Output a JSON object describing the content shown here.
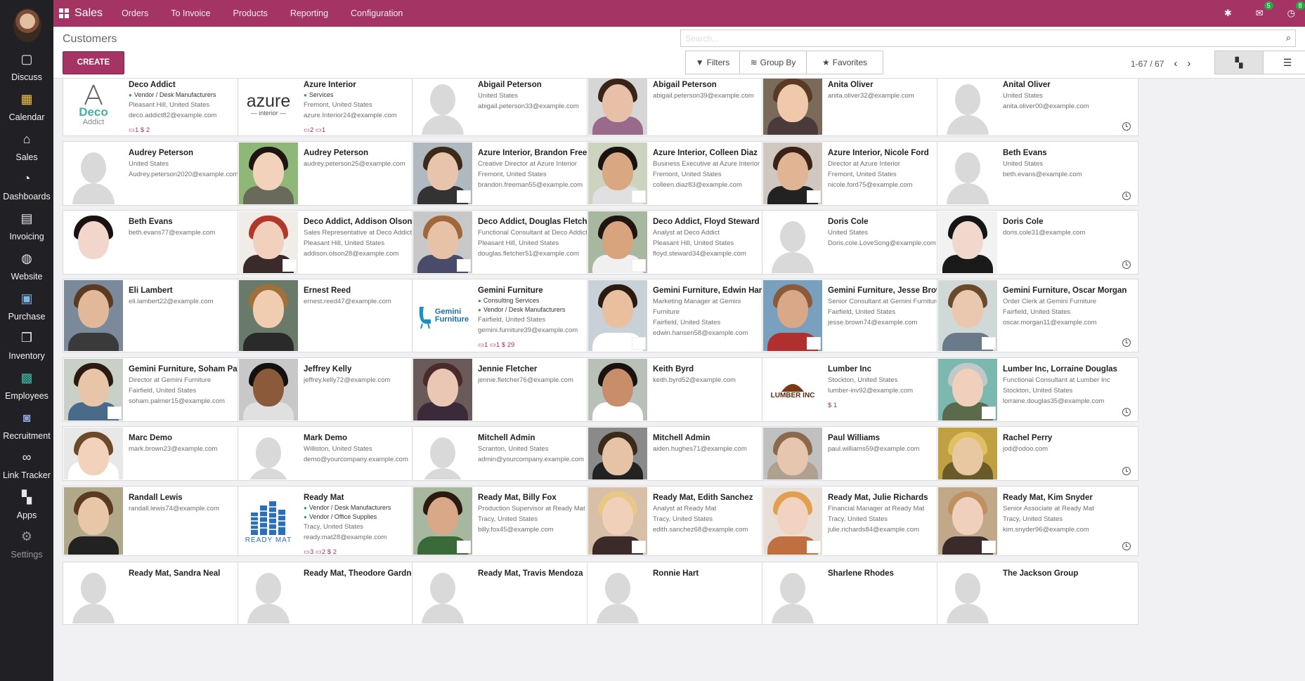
{
  "app": {
    "name": "Sales"
  },
  "topbar": {
    "menu": [
      "Orders",
      "To Invoice",
      "Products",
      "Reporting",
      "Configuration"
    ],
    "messages_count": "5",
    "activities_count": "8"
  },
  "rail": [
    "Discuss",
    "Calendar",
    "Sales",
    "Dashboards",
    "Invoicing",
    "Website",
    "Purchase",
    "Inventory",
    "Employees",
    "Recruitment",
    "Link Tracker",
    "Apps",
    "Settings"
  ],
  "control_panel": {
    "title": "Customers",
    "create_label": "CREATE",
    "search_placeholder": "Search...",
    "filters_label": "Filters",
    "groupby_label": "Group By",
    "favorites_label": "Favorites",
    "pager": "1-67 / 67"
  },
  "cards": [
    {
      "name": "Deco Addict",
      "tags": [
        "Vendor / Desk Manufacturers"
      ],
      "lines": [
        "Pleasant Hill, United States",
        "deco.addict82@example.com"
      ],
      "stats": "▭1   $ 2"
    },
    {
      "name": "Azure Interior",
      "tags": [
        "Services"
      ],
      "lines": [
        "Fremont, United States",
        "azure.Interior24@example.com"
      ],
      "stats": "▭2   ▭1"
    },
    {
      "name": "Abigail Peterson",
      "tags": [],
      "lines": [
        "United States",
        "abigail.peterson33@example.com"
      ],
      "stats": ""
    },
    {
      "name": "Abigail Peterson",
      "tags": [],
      "lines": [
        "abigail.peterson39@example.com"
      ],
      "stats": ""
    },
    {
      "name": "Anita Oliver",
      "tags": [],
      "lines": [
        "anita.oliver32@example.com"
      ],
      "stats": ""
    },
    {
      "name": "Anital Oliver",
      "tags": [],
      "lines": [
        "United States",
        "anita.oliver00@example.com"
      ],
      "stats": ""
    },
    {
      "name": "Audrey Peterson",
      "tags": [],
      "lines": [
        "United States",
        "Audrey.peterson2020@example.com"
      ],
      "stats": ""
    },
    {
      "name": "Audrey Peterson",
      "tags": [],
      "lines": [
        "audrey.peterson25@example.com"
      ],
      "stats": ""
    },
    {
      "name": "Azure Interior, Brandon Freeman",
      "tags": [],
      "lines": [
        "Creative Director at Azure Interior",
        "Fremont, United States",
        "brandon.freeman55@example.com"
      ],
      "stats": ""
    },
    {
      "name": "Azure Interior, Colleen Diaz",
      "tags": [],
      "lines": [
        "Business Executive at Azure Interior",
        "Fremont, United States",
        "colleen.diaz83@example.com"
      ],
      "stats": ""
    },
    {
      "name": "Azure Interior, Nicole Ford",
      "tags": [],
      "lines": [
        "Director at Azure Interior",
        "Fremont, United States",
        "nicole.ford75@example.com"
      ],
      "stats": ""
    },
    {
      "name": "Beth Evans",
      "tags": [],
      "lines": [
        "United States",
        "beth.evans@example.com"
      ],
      "stats": ""
    },
    {
      "name": "Beth Evans",
      "tags": [],
      "lines": [
        "beth.evans77@example.com"
      ],
      "stats": ""
    },
    {
      "name": "Deco Addict, Addison Olson",
      "tags": [],
      "lines": [
        "Sales Representative at Deco Addict",
        "Pleasant Hill, United States",
        "addison.olson28@example.com"
      ],
      "stats": ""
    },
    {
      "name": "Deco Addict, Douglas Fletcher",
      "tags": [],
      "lines": [
        "Functional Consultant at Deco Addict",
        "Pleasant Hill, United States",
        "douglas.fletcher51@example.com"
      ],
      "stats": ""
    },
    {
      "name": "Deco Addict, Floyd Steward",
      "tags": [],
      "lines": [
        "Analyst at Deco Addict",
        "Pleasant Hill, United States",
        "floyd.steward34@example.com"
      ],
      "stats": ""
    },
    {
      "name": "Doris Cole",
      "tags": [],
      "lines": [
        "United States",
        "Doris.cole.LoveSong@example.com"
      ],
      "stats": ""
    },
    {
      "name": "Doris Cole",
      "tags": [],
      "lines": [
        "doris.cole31@example.com"
      ],
      "stats": ""
    },
    {
      "name": "Eli Lambert",
      "tags": [],
      "lines": [
        "eli.lambert22@example.com"
      ],
      "stats": ""
    },
    {
      "name": "Ernest Reed",
      "tags": [],
      "lines": [
        "ernest.reed47@example.com"
      ],
      "stats": ""
    },
    {
      "name": "Gemini Furniture",
      "tags": [
        "Consulting Services",
        "Vendor / Desk Manufacturers"
      ],
      "lines": [
        "Fairfield, United States",
        "gemini.furniture39@example.com"
      ],
      "stats": "▭1   ▭1   $ 29"
    },
    {
      "name": "Gemini Furniture, Edwin Hansen",
      "tags": [],
      "lines": [
        "Marketing Manager at Gemini",
        "Furniture",
        "Fairfield, United States",
        "edwin.hansen58@example.com"
      ],
      "stats": ""
    },
    {
      "name": "Gemini Furniture, Jesse Brown",
      "tags": [],
      "lines": [
        "Senior Consultant at Gemini Furniture",
        "Fairfield, United States",
        "jesse.brown74@example.com"
      ],
      "stats": ""
    },
    {
      "name": "Gemini Furniture, Oscar Morgan",
      "tags": [],
      "lines": [
        "Order Clerk at Gemini Furniture",
        "Fairfield, United States",
        "oscar.morgan11@example.com"
      ],
      "stats": ""
    },
    {
      "name": "Gemini Furniture, Soham Palmer",
      "tags": [],
      "lines": [
        "Director at Gemini Furniture",
        "Fairfield, United States",
        "soham.palmer15@example.com"
      ],
      "stats": ""
    },
    {
      "name": "Jeffrey Kelly",
      "tags": [],
      "lines": [
        "jeffrey.kelly72@example.com"
      ],
      "stats": ""
    },
    {
      "name": "Jennie Fletcher",
      "tags": [],
      "lines": [
        "jennie.fletcher76@example.com"
      ],
      "stats": ""
    },
    {
      "name": "Keith Byrd",
      "tags": [],
      "lines": [
        "keith.byrd52@example.com"
      ],
      "stats": ""
    },
    {
      "name": "Lumber Inc",
      "tags": [],
      "lines": [
        "Stockton, United States",
        "lumber-inv92@example.com"
      ],
      "stats": "$ 1"
    },
    {
      "name": "Lumber Inc, Lorraine Douglas",
      "tags": [],
      "lines": [
        "Functional Consultant at Lumber Inc",
        "Stockton, United States",
        "lorraine.douglas35@example.com"
      ],
      "stats": ""
    },
    {
      "name": "Marc Demo",
      "tags": [],
      "lines": [
        "mark.brown23@example.com"
      ],
      "stats": ""
    },
    {
      "name": "Mark Demo",
      "tags": [],
      "lines": [
        "Williston, United States",
        "demo@yourcompany.example.com"
      ],
      "stats": ""
    },
    {
      "name": "Mitchell Admin",
      "tags": [],
      "lines": [
        "Scranton, United States",
        "admin@yourcompany.example.com"
      ],
      "stats": ""
    },
    {
      "name": "Mitchell Admin",
      "tags": [],
      "lines": [
        "aiden.hughes71@example.com"
      ],
      "stats": ""
    },
    {
      "name": "Paul Williams",
      "tags": [],
      "lines": [
        "paul.williams59@example.com"
      ],
      "stats": ""
    },
    {
      "name": "Rachel Perry",
      "tags": [],
      "lines": [
        "jod@odoo.com"
      ],
      "stats": ""
    },
    {
      "name": "Randall Lewis",
      "tags": [],
      "lines": [
        "randall.lewis74@example.com"
      ],
      "stats": ""
    },
    {
      "name": "Ready Mat",
      "tags": [
        "Vendor / Desk Manufacturers",
        "Vendor / Office Supplies"
      ],
      "lines": [
        "Tracy, United States",
        "ready.mat28@example.com"
      ],
      "stats": "▭3   ▭2   $ 2"
    },
    {
      "name": "Ready Mat, Billy Fox",
      "tags": [],
      "lines": [
        "Production Supervisor at Ready Mat",
        "Tracy, United States",
        "billy.fox45@example.com"
      ],
      "stats": ""
    },
    {
      "name": "Ready Mat, Edith Sanchez",
      "tags": [],
      "lines": [
        "Analyst at Ready Mat",
        "Tracy, United States",
        "edith.sanchez68@example.com"
      ],
      "stats": ""
    },
    {
      "name": "Ready Mat, Julie Richards",
      "tags": [],
      "lines": [
        "Financial Manager at Ready Mat",
        "Tracy, United States",
        "julie.richards84@example.com"
      ],
      "stats": ""
    },
    {
      "name": "Ready Mat, Kim Snyder",
      "tags": [],
      "lines": [
        "Senior Associate at Ready Mat",
        "Tracy, United States",
        "kim.snyder96@example.com"
      ],
      "stats": ""
    },
    {
      "name": "Ready Mat, Sandra Neal",
      "tags": [],
      "lines": [],
      "stats": ""
    },
    {
      "name": "Ready Mat, Theodore Gardner",
      "tags": [],
      "lines": [],
      "stats": ""
    },
    {
      "name": "Ready Mat, Travis Mendoza",
      "tags": [],
      "lines": [],
      "stats": ""
    },
    {
      "name": "Ronnie Hart",
      "tags": [],
      "lines": [],
      "stats": ""
    },
    {
      "name": "Sharlene Rhodes",
      "tags": [],
      "lines": [],
      "stats": ""
    },
    {
      "name": "The Jackson Group",
      "tags": [],
      "lines": [],
      "stats": ""
    }
  ],
  "logos": {
    "deco": [
      "Deco",
      "Addict"
    ],
    "azure": [
      "azure",
      "interior"
    ],
    "gemini": [
      "Gemini",
      "Furniture"
    ],
    "lumber": "LUMBER INC",
    "readymat": "READY MAT"
  }
}
